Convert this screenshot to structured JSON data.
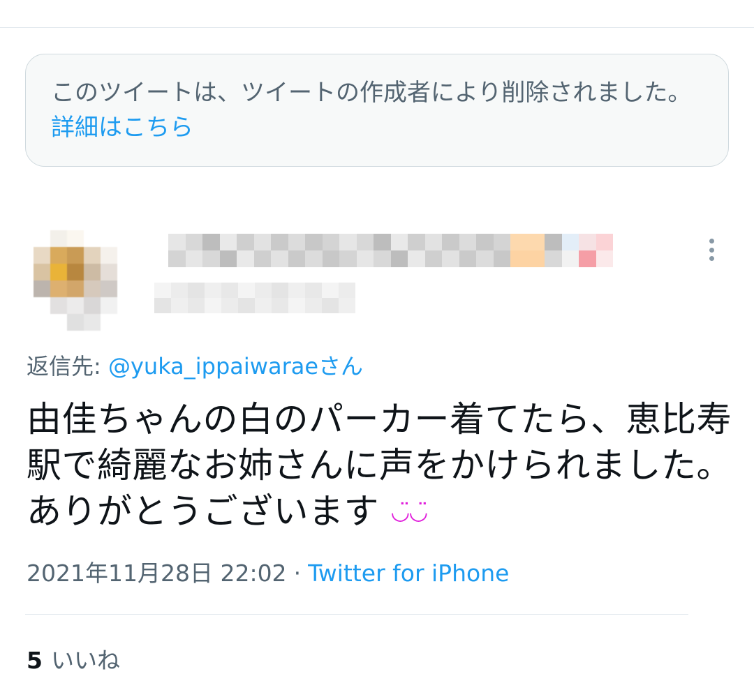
{
  "deleted_notice": {
    "text": "このツイートは、ツイートの作成者により削除されました。",
    "link": "詳細はこちら"
  },
  "reply": {
    "prefix": "返信先: ",
    "handle": "@yuka_ippaiwaraeさん"
  },
  "tweet": {
    "text": "由佳ちゃんの白のパーカー着てたら、恵比寿駅で綺麗なお姉さんに声をかけられました。ありがとうございます",
    "emoji": "◡̈◡̈"
  },
  "meta": {
    "timestamp": "2021年11月28日 22:02",
    "separator": "·",
    "source": "Twitter for iPhone"
  },
  "likes": {
    "count": "5",
    "label": "いいね"
  },
  "icons": {
    "more": "more-vertical-icon",
    "avatar": "avatar-mosaic"
  },
  "colors": {
    "link": "#1d9bf0",
    "secondary_text": "#536471",
    "primary_text": "#0f1419",
    "emoji": "#e01cdb"
  }
}
